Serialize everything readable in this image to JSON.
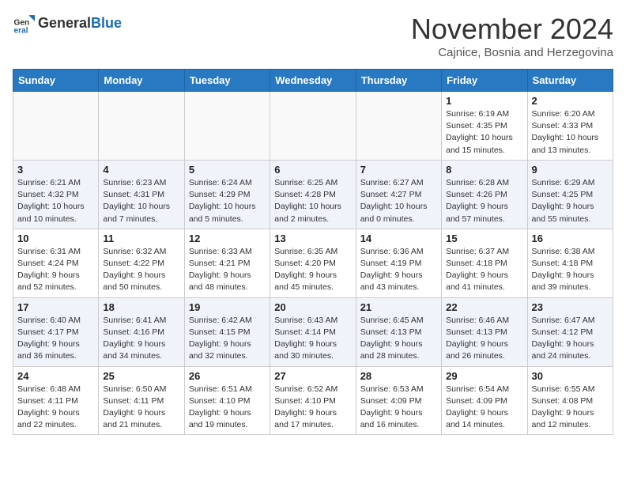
{
  "header": {
    "logo_general": "General",
    "logo_blue": "Blue",
    "month_title": "November 2024",
    "location": "Cajnice, Bosnia and Herzegovina"
  },
  "days_of_week": [
    "Sunday",
    "Monday",
    "Tuesday",
    "Wednesday",
    "Thursday",
    "Friday",
    "Saturday"
  ],
  "weeks": [
    [
      {
        "day": "",
        "info": ""
      },
      {
        "day": "",
        "info": ""
      },
      {
        "day": "",
        "info": ""
      },
      {
        "day": "",
        "info": ""
      },
      {
        "day": "",
        "info": ""
      },
      {
        "day": "1",
        "info": "Sunrise: 6:19 AM\nSunset: 4:35 PM\nDaylight: 10 hours\nand 15 minutes."
      },
      {
        "day": "2",
        "info": "Sunrise: 6:20 AM\nSunset: 4:33 PM\nDaylight: 10 hours\nand 13 minutes."
      }
    ],
    [
      {
        "day": "3",
        "info": "Sunrise: 6:21 AM\nSunset: 4:32 PM\nDaylight: 10 hours\nand 10 minutes."
      },
      {
        "day": "4",
        "info": "Sunrise: 6:23 AM\nSunset: 4:31 PM\nDaylight: 10 hours\nand 7 minutes."
      },
      {
        "day": "5",
        "info": "Sunrise: 6:24 AM\nSunset: 4:29 PM\nDaylight: 10 hours\nand 5 minutes."
      },
      {
        "day": "6",
        "info": "Sunrise: 6:25 AM\nSunset: 4:28 PM\nDaylight: 10 hours\nand 2 minutes."
      },
      {
        "day": "7",
        "info": "Sunrise: 6:27 AM\nSunset: 4:27 PM\nDaylight: 10 hours\nand 0 minutes."
      },
      {
        "day": "8",
        "info": "Sunrise: 6:28 AM\nSunset: 4:26 PM\nDaylight: 9 hours\nand 57 minutes."
      },
      {
        "day": "9",
        "info": "Sunrise: 6:29 AM\nSunset: 4:25 PM\nDaylight: 9 hours\nand 55 minutes."
      }
    ],
    [
      {
        "day": "10",
        "info": "Sunrise: 6:31 AM\nSunset: 4:24 PM\nDaylight: 9 hours\nand 52 minutes."
      },
      {
        "day": "11",
        "info": "Sunrise: 6:32 AM\nSunset: 4:22 PM\nDaylight: 9 hours\nand 50 minutes."
      },
      {
        "day": "12",
        "info": "Sunrise: 6:33 AM\nSunset: 4:21 PM\nDaylight: 9 hours\nand 48 minutes."
      },
      {
        "day": "13",
        "info": "Sunrise: 6:35 AM\nSunset: 4:20 PM\nDaylight: 9 hours\nand 45 minutes."
      },
      {
        "day": "14",
        "info": "Sunrise: 6:36 AM\nSunset: 4:19 PM\nDaylight: 9 hours\nand 43 minutes."
      },
      {
        "day": "15",
        "info": "Sunrise: 6:37 AM\nSunset: 4:18 PM\nDaylight: 9 hours\nand 41 minutes."
      },
      {
        "day": "16",
        "info": "Sunrise: 6:38 AM\nSunset: 4:18 PM\nDaylight: 9 hours\nand 39 minutes."
      }
    ],
    [
      {
        "day": "17",
        "info": "Sunrise: 6:40 AM\nSunset: 4:17 PM\nDaylight: 9 hours\nand 36 minutes."
      },
      {
        "day": "18",
        "info": "Sunrise: 6:41 AM\nSunset: 4:16 PM\nDaylight: 9 hours\nand 34 minutes."
      },
      {
        "day": "19",
        "info": "Sunrise: 6:42 AM\nSunset: 4:15 PM\nDaylight: 9 hours\nand 32 minutes."
      },
      {
        "day": "20",
        "info": "Sunrise: 6:43 AM\nSunset: 4:14 PM\nDaylight: 9 hours\nand 30 minutes."
      },
      {
        "day": "21",
        "info": "Sunrise: 6:45 AM\nSunset: 4:13 PM\nDaylight: 9 hours\nand 28 minutes."
      },
      {
        "day": "22",
        "info": "Sunrise: 6:46 AM\nSunset: 4:13 PM\nDaylight: 9 hours\nand 26 minutes."
      },
      {
        "day": "23",
        "info": "Sunrise: 6:47 AM\nSunset: 4:12 PM\nDaylight: 9 hours\nand 24 minutes."
      }
    ],
    [
      {
        "day": "24",
        "info": "Sunrise: 6:48 AM\nSunset: 4:11 PM\nDaylight: 9 hours\nand 22 minutes."
      },
      {
        "day": "25",
        "info": "Sunrise: 6:50 AM\nSunset: 4:11 PM\nDaylight: 9 hours\nand 21 minutes."
      },
      {
        "day": "26",
        "info": "Sunrise: 6:51 AM\nSunset: 4:10 PM\nDaylight: 9 hours\nand 19 minutes."
      },
      {
        "day": "27",
        "info": "Sunrise: 6:52 AM\nSunset: 4:10 PM\nDaylight: 9 hours\nand 17 minutes."
      },
      {
        "day": "28",
        "info": "Sunrise: 6:53 AM\nSunset: 4:09 PM\nDaylight: 9 hours\nand 16 minutes."
      },
      {
        "day": "29",
        "info": "Sunrise: 6:54 AM\nSunset: 4:09 PM\nDaylight: 9 hours\nand 14 minutes."
      },
      {
        "day": "30",
        "info": "Sunrise: 6:55 AM\nSunset: 4:08 PM\nDaylight: 9 hours\nand 12 minutes."
      }
    ]
  ]
}
